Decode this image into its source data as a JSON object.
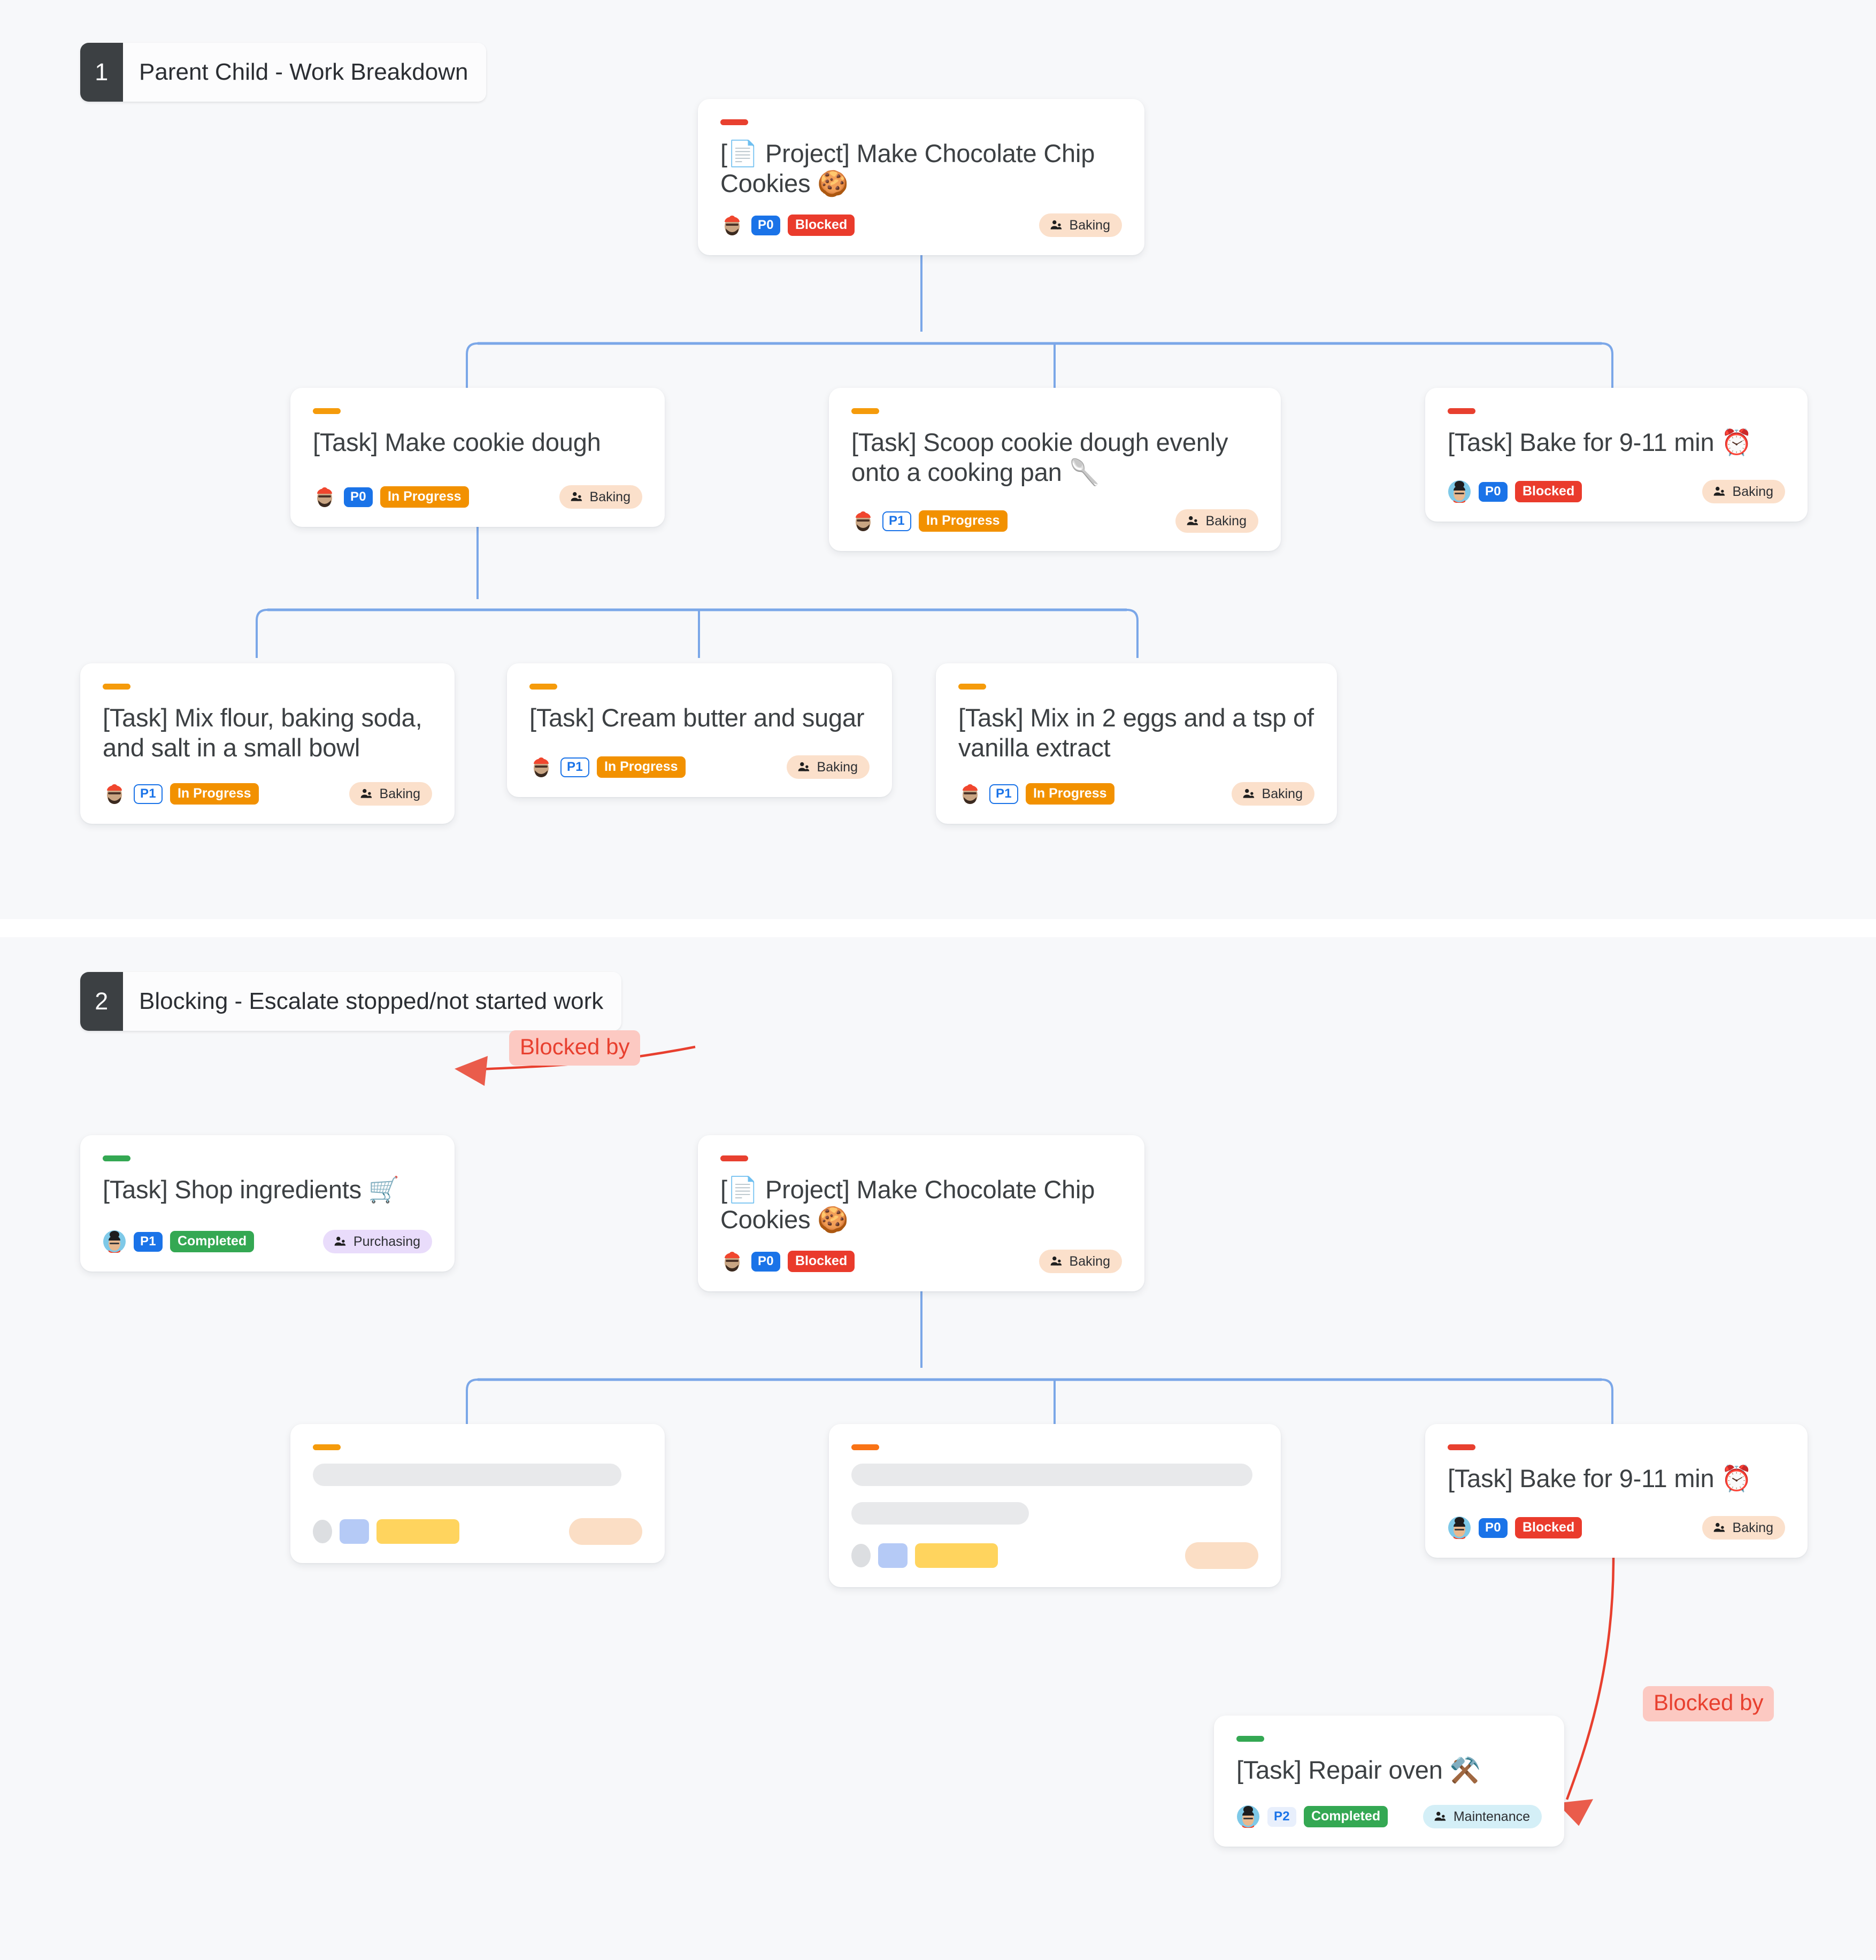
{
  "sections": [
    {
      "number": "1",
      "title": "Parent Child - Work Breakdown"
    },
    {
      "number": "2",
      "title": "Blocking - Escalate stopped/not started work"
    }
  ],
  "colors": {
    "canvas": "#f7f8fa",
    "card": "#ffffff",
    "connector": "#7ba7e8",
    "blocked_edge": "#e8402f",
    "accent_red": "#e8402f",
    "accent_orange": "#f59b0b",
    "accent_green": "#34a853",
    "priority_blue": "#1a73e8",
    "status_blocked": "#ea3b2c",
    "status_inprogress": "#f29100",
    "status_completed": "#34a853"
  },
  "labels": {
    "blocked_by": "Blocked by",
    "team_icon": "people-icon",
    "doc_icon": "document-icon"
  },
  "cards": {
    "project_root": {
      "title": "[📄 Project] Make Chocolate Chip Cookies 🍪",
      "priority": "P0",
      "status": "Blocked",
      "team": "Baking",
      "accent": "red",
      "avatar": "man-red-beanie-avatar"
    },
    "make_dough": {
      "title": "[Task] Make cookie dough",
      "priority": "P0",
      "status": "In Progress",
      "team": "Baking",
      "accent": "orange",
      "avatar": "man-red-beanie-avatar"
    },
    "scoop_dough": {
      "title": "[Task] Scoop cookie dough evenly onto a cooking pan 🥄",
      "priority": "P1",
      "status": "In Progress",
      "team": "Baking",
      "accent": "orange",
      "avatar": "man-red-beanie-avatar"
    },
    "bake": {
      "title": "[Task] Bake for 9-11 min ⏰",
      "priority": "P0",
      "status": "Blocked",
      "team": "Baking",
      "accent": "red",
      "avatar": "woman-bun-avatar"
    },
    "mix_flour": {
      "title": "[Task] Mix flour, baking soda, and salt in a small bowl",
      "priority": "P1",
      "status": "In Progress",
      "team": "Baking",
      "accent": "orange",
      "avatar": "man-red-beanie-avatar"
    },
    "cream_butter": {
      "title": "[Task] Cream butter and sugar",
      "priority": "P1",
      "status": "In Progress",
      "team": "Baking",
      "accent": "orange",
      "avatar": "man-red-beanie-avatar"
    },
    "mix_eggs": {
      "title": "[Task] Mix in 2 eggs and a tsp of vanilla extract",
      "priority": "P1",
      "status": "In Progress",
      "team": "Baking",
      "accent": "orange",
      "avatar": "man-red-beanie-avatar"
    },
    "shop_ingredients": {
      "title": "[Task] Shop ingredients 🛒",
      "priority": "P1",
      "status": "Completed",
      "team": "Purchasing",
      "accent": "green",
      "avatar": "woman-bun-avatar"
    },
    "repair_oven": {
      "title": "[Task] Repair oven ⚒️",
      "priority": "P2",
      "status": "Completed",
      "team": "Maintenance",
      "accent": "green",
      "avatar": "woman-bun-avatar"
    }
  },
  "skeleton_cards": [
    {
      "accent": "orange",
      "lines": 1,
      "name": "loading-card-left"
    },
    {
      "accent": "orange2",
      "lines": 2,
      "name": "loading-card-center"
    }
  ]
}
